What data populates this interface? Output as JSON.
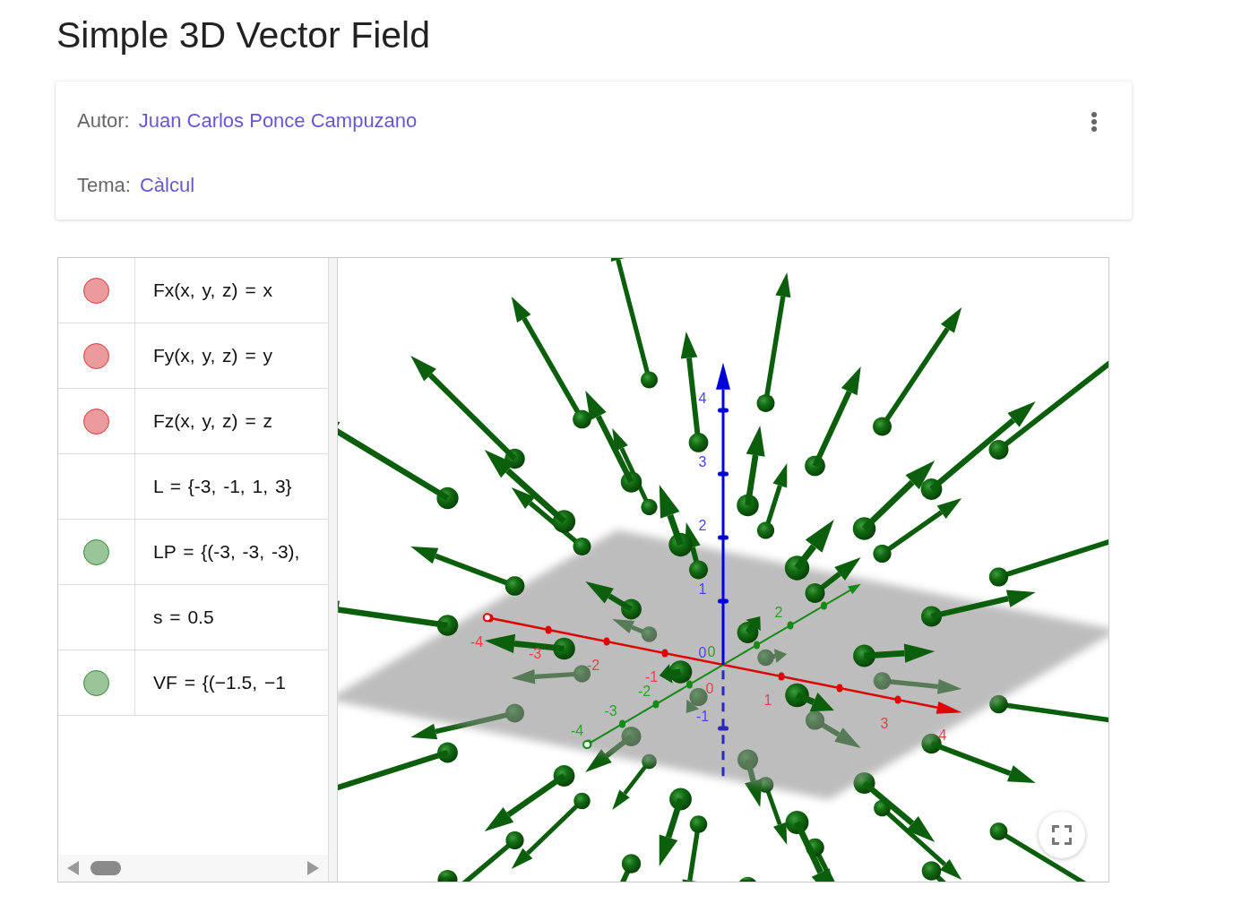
{
  "page": {
    "title": "Simple 3D Vector Field"
  },
  "info_card": {
    "fields": [
      {
        "label": "Autor:",
        "value": "Juan Carlos Ponce Campuzano"
      },
      {
        "label": "Tema:",
        "value": "Càlcul"
      }
    ]
  },
  "applet": {
    "algebra_view": {
      "rows": [
        {
          "text": "Fx(x, y, z) = x",
          "color": "#eb9b9b"
        },
        {
          "text": "Fy(x, y, z) = y",
          "color": "#eb9b9b"
        },
        {
          "text": "Fz(x, y, z) = z",
          "color": "#eb9b9b"
        },
        {
          "text": "L = {-3, -1, 1, 3}"
        },
        {
          "text": "LP = {(-3, -3, -3),",
          "color": "#9ac49a"
        },
        {
          "text": "s = 0.5"
        },
        {
          "text": "VF = {(−1.5, −1",
          "color": "#9ac49a"
        }
      ]
    },
    "graphics_view": {
      "axes": [
        {
          "kind": "x",
          "labels": [
            "-4",
            "-3",
            "-2",
            "-1",
            "0",
            "1",
            "3",
            "4"
          ]
        },
        {
          "kind": "y",
          "labels": [
            "-4",
            "-3",
            "-2",
            "0",
            "2"
          ]
        },
        {
          "kind": "z",
          "labels": [
            "4",
            "3",
            "2",
            "1",
            "0",
            "-1"
          ]
        }
      ]
    }
  }
}
